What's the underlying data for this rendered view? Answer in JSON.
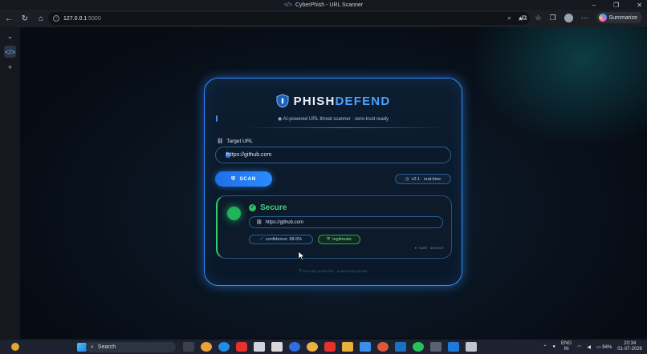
{
  "window": {
    "title": "CyberPhish - URL Scanner",
    "controls": [
      "–",
      "❐",
      "✕"
    ]
  },
  "browser": {
    "address_host": "127.0.0.1",
    "address_port": ":5000",
    "summarize_label": "Summarize"
  },
  "app": {
    "brand_prefix": "PHISH",
    "brand_suffix": "DEFEND",
    "tagline": "AI-powered URL threat scanner · zero-trust ready",
    "url_label": "Target URL",
    "url_value_first": "h",
    "url_value_rest": "ttps://github.com",
    "scan_label": "SCAN",
    "version_badge": "v2.1 · real-time",
    "result": {
      "verdict": "Secure",
      "url": "https://github.com",
      "confidence": "confidence: 68.5%",
      "label": "legitimate",
      "meta": "hash · secured"
    },
    "footer": "zero-day protection · powered by pocket"
  },
  "taskbar": {
    "search_placeholder": "Search",
    "lang_top": "ENG",
    "lang_bottom": "IN",
    "battery": "94%",
    "time": "20:34",
    "date": "01-07-2026"
  },
  "colors": {
    "accent": "#2f8dff",
    "success": "#3fd37a",
    "background": "#070c14"
  },
  "icons": [
    "back-icon",
    "refresh-icon",
    "home-icon",
    "info-icon",
    "search-icon",
    "star-icon",
    "extensions-icon",
    "favorites-icon",
    "avatar",
    "more-icon",
    "shield-icon",
    "link-icon",
    "check-icon"
  ]
}
